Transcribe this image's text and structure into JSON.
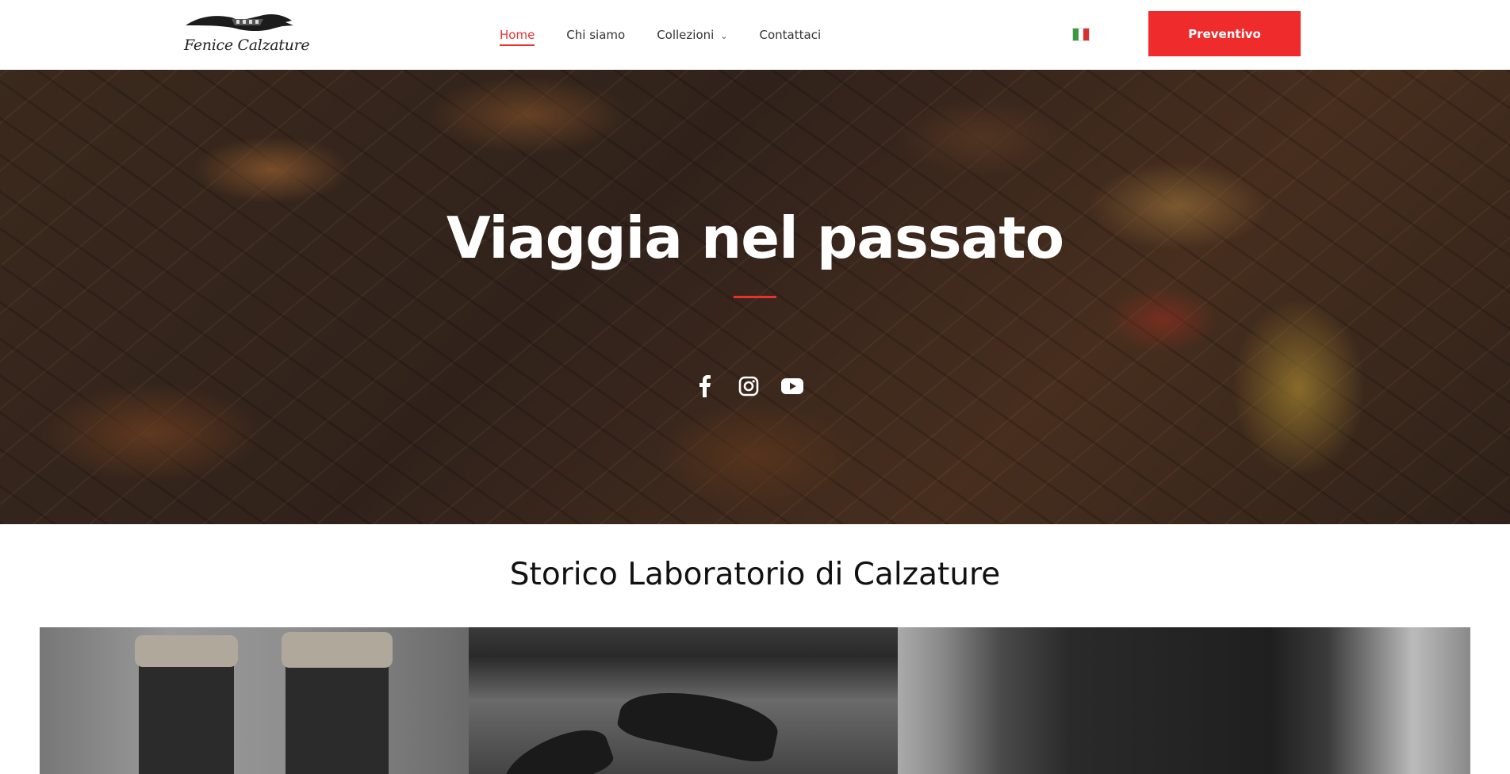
{
  "header": {
    "logo_text": "Fenice Calzature",
    "nav": [
      {
        "label": "Home",
        "active": true
      },
      {
        "label": "Chi siamo",
        "active": false
      },
      {
        "label": "Collezioni",
        "active": false,
        "has_dropdown": true
      },
      {
        "label": "Contattaci",
        "active": false
      }
    ],
    "language_flag": "italy-flag-icon",
    "cta_label": "Preventivo"
  },
  "hero": {
    "title": "Viaggia nel passato",
    "social_icons": [
      "facebook-icon",
      "instagram-icon",
      "youtube-icon"
    ]
  },
  "section": {
    "title": "Storico Laboratorio di Calzature"
  },
  "colors": {
    "accent": "#e8302f",
    "cta_bg": "#f02b2b",
    "text_dark": "#111111"
  }
}
